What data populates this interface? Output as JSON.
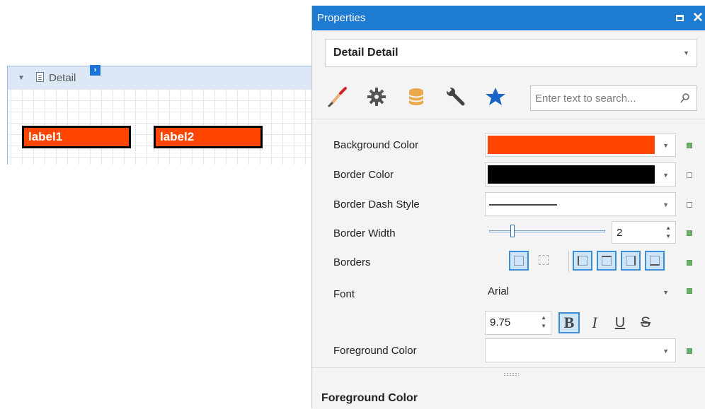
{
  "designer": {
    "band_title": "Detail",
    "smart_tag_glyph": "›",
    "labels": [
      {
        "text": "label1",
        "background": "#ff4500",
        "border": "#000000"
      },
      {
        "text": "label2",
        "background": "#ff4500",
        "border": "#000000"
      }
    ]
  },
  "panel": {
    "title": "Properties",
    "close_glyph": "✕",
    "selector": {
      "value": "Detail  Detail"
    },
    "tabs": [
      "appearance-brush-icon",
      "behavior-gear-icon",
      "data-database-icon",
      "layout-wrench-icon",
      "favorites-star-icon"
    ],
    "search": {
      "placeholder": "Enter text to search..."
    },
    "properties": {
      "background_color": {
        "label": "Background Color",
        "value": "#ff4500"
      },
      "border_color": {
        "label": "Border Color",
        "value": "#000000"
      },
      "border_dash_style": {
        "label": "Border Dash Style",
        "value": "solid-line"
      },
      "border_width": {
        "label": "Border Width",
        "value": "2",
        "slider_level": 0.2
      },
      "borders": {
        "label": "Borders"
      },
      "font": {
        "label": "Font",
        "family": "Arial",
        "size": "9.75",
        "bold": "B",
        "italic": "I",
        "underline": "U",
        "strike": "S"
      },
      "foreground_color": {
        "label": "Foreground Color",
        "value": ""
      }
    },
    "description_title": "Foreground Color",
    "colors": {
      "accent": "#1e7bd2",
      "modified": "#6bb06b"
    }
  }
}
